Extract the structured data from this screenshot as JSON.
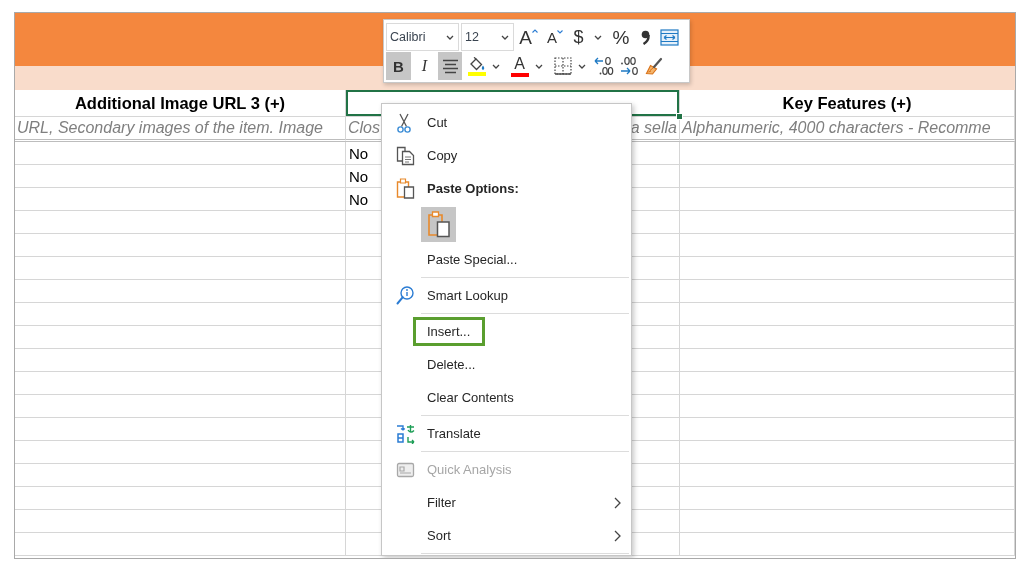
{
  "sheet": {
    "columns": [
      {
        "label": "Additional Image URL 3 (+)",
        "selected": false
      },
      {
        "selected": true
      },
      {
        "label": "Key Features (+)",
        "selected": false
      }
    ],
    "descriptions": [
      {
        "kind": "text",
        "text": "URL, Secondary images of the item. Image"
      },
      {
        "kind": "fragments",
        "fragments": [
          "Clos",
          "a sella"
        ]
      },
      {
        "kind": "text",
        "text": "Alphanumeric, 4000 characters - Recomme"
      }
    ],
    "rows": [
      {
        "column_2": "No"
      },
      {
        "column_2": "No"
      },
      {
        "column_2": "No"
      }
    ]
  },
  "mini_toolbar": {
    "font": "Calibri",
    "size": "12",
    "row_1": [
      {
        "kind": "grow-font",
        "label": "A"
      },
      {
        "kind": "shrink-font",
        "label": "A"
      },
      {
        "kind": "currency",
        "label": "$",
        "dropdown": true
      },
      {
        "kind": "percent",
        "label": "%"
      },
      {
        "kind": "comma"
      },
      {
        "kind": "merge"
      }
    ],
    "row_2": [
      {
        "kind": "bold",
        "label": "B",
        "on": true
      },
      {
        "kind": "italic",
        "label": "I",
        "on": false
      },
      {
        "kind": "center",
        "on": true
      },
      {
        "kind": "fill-color",
        "color": "#ffff00",
        "dropdown": true
      },
      {
        "kind": "font-color",
        "label": "A",
        "color": "#ff0000",
        "dropdown": true
      },
      {
        "kind": "borders",
        "dropdown": true
      },
      {
        "kind": "increase-decimal"
      },
      {
        "kind": "decrease-decimal"
      },
      {
        "kind": "format-painter"
      }
    ]
  },
  "context_menu": {
    "items": [
      {
        "kind": "cut",
        "label": "Cut",
        "disabled": false,
        "highlighted": false,
        "submenu": false
      },
      {
        "kind": "copy",
        "label": "Copy",
        "disabled": false,
        "highlighted": false,
        "submenu": false
      },
      {
        "kind": "heading",
        "label": "Paste Options:"
      },
      {
        "kind": "paste-options",
        "options": [
          {
            "selected": true
          }
        ]
      },
      {
        "kind": "command",
        "label": "Paste Special...",
        "disabled": false,
        "highlighted": false,
        "submenu": false
      },
      {
        "kind": "separator"
      },
      {
        "kind": "lookup",
        "label": "Smart Lookup",
        "disabled": false,
        "highlighted": false,
        "submenu": false
      },
      {
        "kind": "separator"
      },
      {
        "kind": "command",
        "label": "Insert...",
        "disabled": false,
        "highlighted": true,
        "submenu": false
      },
      {
        "kind": "command",
        "label": "Delete...",
        "disabled": false,
        "highlighted": false,
        "submenu": false
      },
      {
        "kind": "command",
        "label": "Clear Contents",
        "disabled": false,
        "highlighted": false,
        "submenu": false
      },
      {
        "kind": "separator"
      },
      {
        "kind": "translate",
        "label": "Translate",
        "disabled": false,
        "highlighted": false,
        "submenu": false
      },
      {
        "kind": "separator"
      },
      {
        "kind": "analysis",
        "label": "Quick Analysis",
        "disabled": true,
        "highlighted": false,
        "submenu": false
      },
      {
        "kind": "command",
        "label": "Filter",
        "disabled": false,
        "highlighted": false,
        "submenu": true
      },
      {
        "kind": "command",
        "label": "Sort",
        "disabled": false,
        "highlighted": false,
        "submenu": true
      },
      {
        "kind": "separator"
      }
    ]
  }
}
